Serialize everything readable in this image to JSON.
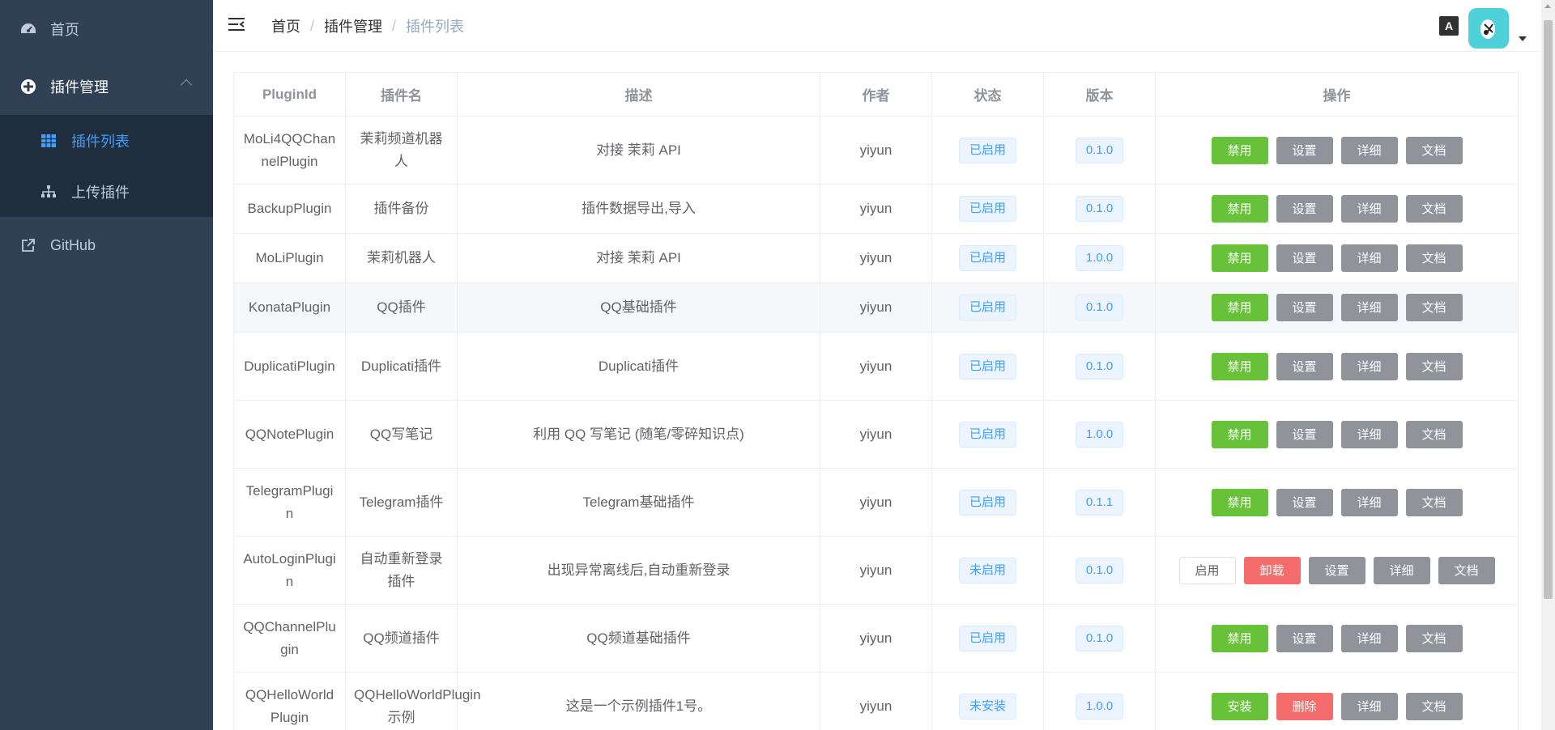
{
  "sidebar": {
    "home": "首页",
    "plugin_manage": "插件管理",
    "plugin_list": "插件列表",
    "upload_plugin": "上传插件",
    "github": "GitHub"
  },
  "breadcrumb": [
    "首页",
    "插件管理",
    "插件列表"
  ],
  "navbar": {
    "lang_icon": "A"
  },
  "table": {
    "headers": [
      "PluginId",
      "插件名",
      "描述",
      "作者",
      "状态",
      "版本",
      "操作"
    ],
    "rows": [
      {
        "id": "MoLi4QQChannelPlugin",
        "name": "茉莉频道机器人",
        "desc": "对接 茉莉 API",
        "author": "yiyun",
        "status": "已启用",
        "version": "0.1.0",
        "actions": [
          "禁用",
          "设置",
          "详细",
          "文档"
        ]
      },
      {
        "id": "BackupPlugin",
        "name": "插件备份",
        "desc": "插件数据导出,导入",
        "author": "yiyun",
        "status": "已启用",
        "version": "0.1.0",
        "actions": [
          "禁用",
          "设置",
          "详细",
          "文档"
        ]
      },
      {
        "id": "MoLiPlugin",
        "name": "茉莉机器人",
        "desc": "对接 茉莉 API",
        "author": "yiyun",
        "status": "已启用",
        "version": "1.0.0",
        "actions": [
          "禁用",
          "设置",
          "详细",
          "文档"
        ]
      },
      {
        "id": "KonataPlugin",
        "name": "QQ插件",
        "desc": "QQ基础插件",
        "author": "yiyun",
        "status": "已启用",
        "version": "0.1.0",
        "actions": [
          "禁用",
          "设置",
          "详细",
          "文档"
        ]
      },
      {
        "id": "DuplicatiPlugin",
        "name": "Duplicati插件",
        "desc": "Duplicati插件",
        "author": "yiyun",
        "status": "已启用",
        "version": "0.1.0",
        "actions": [
          "禁用",
          "设置",
          "详细",
          "文档"
        ]
      },
      {
        "id": "QQNotePlugin",
        "name": "QQ写笔记",
        "desc": "利用 QQ 写笔记 (随笔/零碎知识点)",
        "author": "yiyun",
        "status": "已启用",
        "version": "1.0.0",
        "actions": [
          "禁用",
          "设置",
          "详细",
          "文档"
        ]
      },
      {
        "id": "TelegramPlugin",
        "name": "Telegram插件",
        "desc": "Telegram基础插件",
        "author": "yiyun",
        "status": "已启用",
        "version": "0.1.1",
        "actions": [
          "禁用",
          "设置",
          "详细",
          "文档"
        ]
      },
      {
        "id": "AutoLoginPlugin",
        "name": "自动重新登录插件",
        "desc": "出现异常离线后,自动重新登录",
        "author": "yiyun",
        "status": "未启用",
        "version": "0.1.0",
        "actions": [
          "启用",
          "卸载",
          "设置",
          "详细",
          "文档"
        ]
      },
      {
        "id": "QQChannelPlugin",
        "name": "QQ频道插件",
        "desc": "QQ频道基础插件",
        "author": "yiyun",
        "status": "已启用",
        "version": "0.1.0",
        "actions": [
          "禁用",
          "设置",
          "详细",
          "文档"
        ]
      },
      {
        "id": "QQHelloWorldPlugin",
        "name": "QQHelloWorldPlugin 示例",
        "desc": "这是一个示例插件1号。",
        "author": "yiyun",
        "status": "未安装",
        "version": "1.0.0",
        "actions": [
          "安装",
          "删除",
          "详细",
          "文档"
        ]
      }
    ]
  },
  "colors": {
    "sidebar_bg": "#304156",
    "submenu_bg": "#1f2d3d",
    "accent": "#409eff",
    "success": "#67c23a",
    "danger": "#f56c6c",
    "info": "#909399"
  }
}
